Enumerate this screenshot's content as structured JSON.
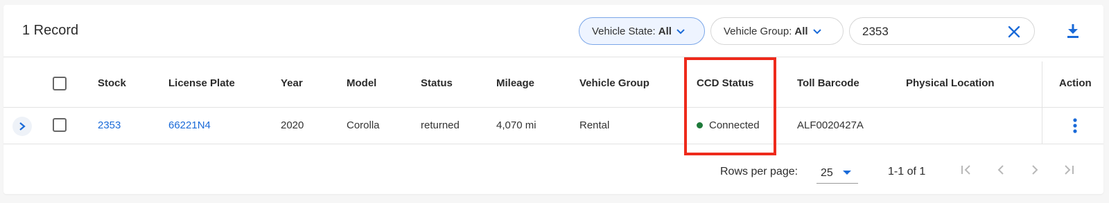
{
  "toolbar": {
    "record_count": "1 Record",
    "vehicle_state": {
      "label": "Vehicle State:",
      "value": "All"
    },
    "vehicle_group": {
      "label": "Vehicle Group:",
      "value": "All"
    },
    "search": {
      "value": "2353",
      "clear_icon": "close-icon"
    },
    "download_icon": "download-icon"
  },
  "table": {
    "columns": [
      "Stock",
      "License Plate",
      "Year",
      "Model",
      "Status",
      "Mileage",
      "Vehicle Group",
      "CCD Status",
      "Toll Barcode",
      "Physical Location",
      "Action"
    ],
    "rows": [
      {
        "stock": "2353",
        "license_plate": "66221N4",
        "year": "2020",
        "model": "Corolla",
        "status": "returned",
        "mileage": "4,070 mi",
        "vehicle_group": "Rental",
        "ccd_status": "Connected",
        "toll_barcode": "ALF0020427A",
        "physical_location": ""
      }
    ]
  },
  "pagination": {
    "rows_per_page_label": "Rows per page:",
    "rows_per_page": "25",
    "range": "1-1 of 1"
  },
  "colors": {
    "accent": "#1a6ad8",
    "connected": "#1e7a3a",
    "highlight": "#ee2a1b"
  }
}
